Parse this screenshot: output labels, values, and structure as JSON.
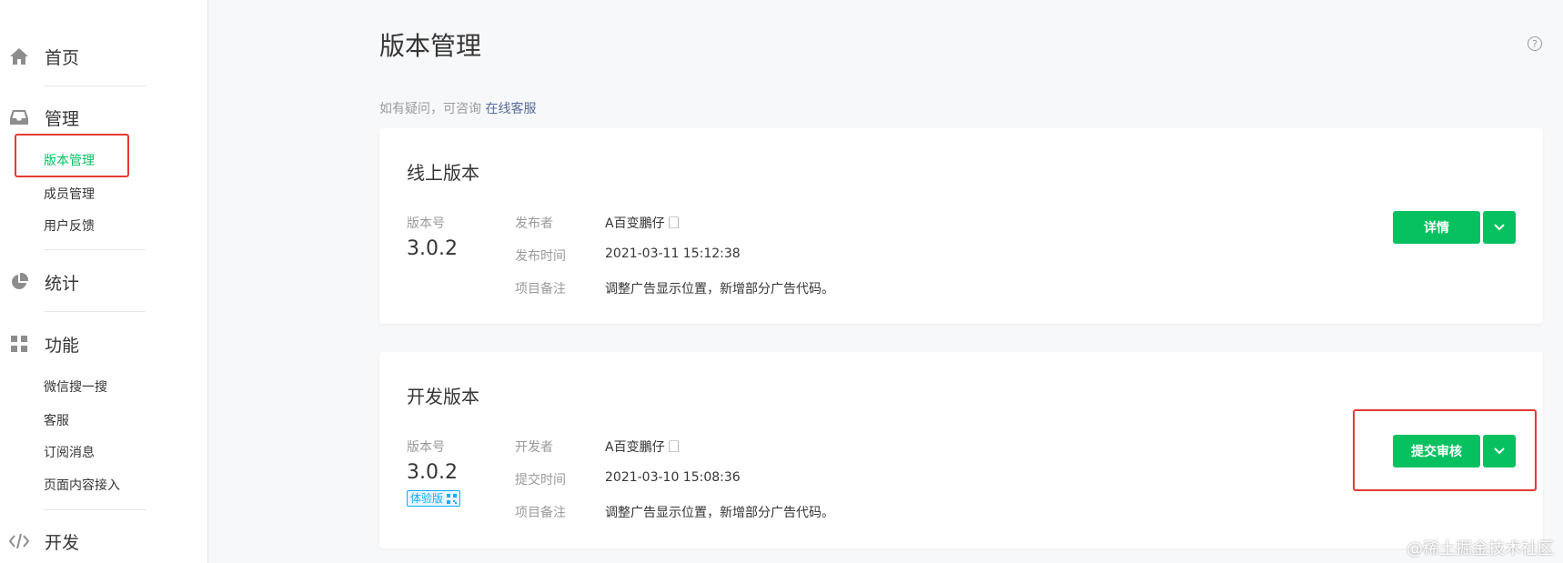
{
  "sidebar": {
    "home": {
      "label": "首页",
      "icon": "home-icon"
    },
    "manage": {
      "label": "管理",
      "icon": "inbox-icon",
      "items": [
        "版本管理",
        "成员管理",
        "用户反馈"
      ]
    },
    "stats": {
      "label": "统计",
      "icon": "pie-chart-icon"
    },
    "features": {
      "label": "功能",
      "icon": "grid-icon",
      "items": [
        "微信搜一搜",
        "客服",
        "订阅消息",
        "页面内容接入"
      ]
    },
    "dev": {
      "label": "开发",
      "icon": "code-icon"
    }
  },
  "page": {
    "title": "版本管理",
    "help": "?",
    "hint_text": "如有疑问，可咨询",
    "hint_link": "在线客服"
  },
  "online": {
    "title": "线上版本",
    "version_label": "版本号",
    "version": "3.0.2",
    "publisher_key": "发布者",
    "publisher": "A百变鵬仔 🗌",
    "time_key": "发布时间",
    "time": "2021-03-11 15:12:38",
    "note_key": "项目备注",
    "note": "调整广告显示位置，新增部分广告代码。",
    "detail_button": "详情"
  },
  "dev_version": {
    "title": "开发版本",
    "version_label": "版本号",
    "version": "3.0.2",
    "badge": "体验版",
    "developer_key": "开发者",
    "developer": "A百变鵬仔 🗌",
    "time_key": "提交时间",
    "time": "2021-03-10 15:08:36",
    "note_key": "项目备注",
    "note": "调整广告显示位置，新增部分广告代码。",
    "submit_button": "提交审核"
  },
  "watermark": "@稀土掘金技术社区",
  "colors": {
    "accent": "#07c160",
    "link": "#576b95",
    "highlight": "#e53935"
  }
}
